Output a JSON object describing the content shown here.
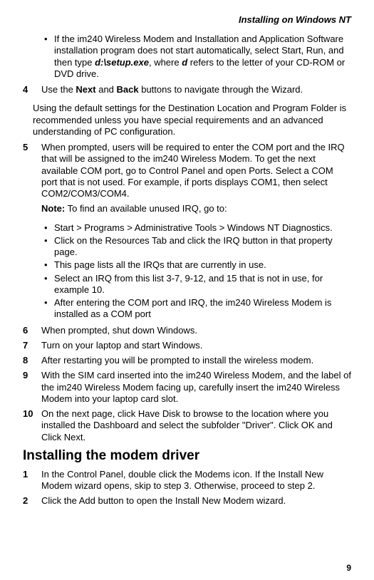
{
  "header": "Installing on Windows NT",
  "bulletA": {
    "items": [
      {
        "pre": "If the im240 Wireless Modem and Installation and Application Software installation program does not start automatically, select Start, Run, and then type ",
        "bold": "d:\\setup.exe",
        "mid": ", where ",
        "bold2": "d",
        "post": " refers to the letter of your CD-ROM or DVD drive."
      }
    ]
  },
  "step4": {
    "num": "4",
    "line1a": "Use the ",
    "line1b": "Next",
    "line1c": " and ",
    "line1d": "Back",
    "line1e": " buttons to navigate through the Wizard.",
    "para": "Using the default settings for the Destination Location and Program Folder is recommended unless you have special requirements and an advanced understanding of PC configuration."
  },
  "step5": {
    "num": "5",
    "body": "When prompted, users will be required to enter the COM port and the IRQ that will be assigned to the im240 Wireless Modem. To get the next available COM port, go to Control Panel and open Ports. Select a COM port that is not used. For example, if ports displays COM1, then select COM2/COM3/COM4.",
    "noteLabel": "Note:",
    "noteText": " To find an available unused IRQ, go to:"
  },
  "bulletB": {
    "items": [
      "Start > Programs > Administrative Tools > Windows NT Diagnostics.",
      "Click on the Resources Tab and click the IRQ button in that property page.",
      "This page lists all the IRQs that are currently in use.",
      "Select an IRQ from this list 3-7, 9-12, and 15 that is not in use, for example 10.",
      "After entering the COM port and IRQ, the im240 Wireless Modem is installed as a COM port"
    ]
  },
  "step6": {
    "num": "6",
    "body": "When prompted, shut down Windows."
  },
  "step7": {
    "num": "7",
    "body": "Turn on your laptop and start Windows."
  },
  "step8": {
    "num": "8",
    "body": "After restarting you will be prompted to install the wireless modem."
  },
  "step9": {
    "num": "9",
    "body": "With the SIM card inserted into the im240 Wireless Modem, and the label of the im240 Wireless Modem facing up, carefully insert the im240 Wireless Modem into your laptop card slot."
  },
  "step10": {
    "num": "10",
    "body": "On the next page, click Have Disk to browse to the location where you installed the Dashboard and select the subfolder \"Driver\". Click OK and Click Next."
  },
  "h2": "Installing the modem driver",
  "stepD1": {
    "num": "1",
    "body": "In the Control Panel, double click the Modems icon. If the Install New Modem wizard opens, skip to step 3. Otherwise, proceed to step 2."
  },
  "stepD2": {
    "num": "2",
    "body": "Click the Add button to open the Install New Modem wizard."
  },
  "pageNum": "9"
}
